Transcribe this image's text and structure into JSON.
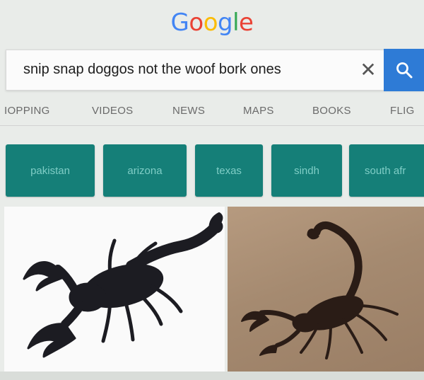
{
  "logo": {
    "letters": [
      {
        "ch": "G",
        "color": "#4285f4"
      },
      {
        "ch": "o",
        "color": "#ea4335"
      },
      {
        "ch": "o",
        "color": "#fbbc05"
      },
      {
        "ch": "g",
        "color": "#4285f4"
      },
      {
        "ch": "l",
        "color": "#34a853"
      },
      {
        "ch": "e",
        "color": "#ea4335"
      }
    ]
  },
  "search": {
    "query": "snip snap doggos not the woof bork ones",
    "clear_icon": "close-icon",
    "button_icon": "search-icon",
    "button_color": "#2e7bd6"
  },
  "tabs": [
    "IOPPING",
    "VIDEOS",
    "NEWS",
    "MAPS",
    "BOOKS",
    "FLIG"
  ],
  "chips": [
    "pakistan",
    "arizona",
    "texas",
    "sindh",
    "south afr"
  ],
  "colors": {
    "chip_bg": "#157f78",
    "chip_text": "#7fcdc6"
  },
  "images": [
    {
      "subject": "scorpion",
      "background": "white"
    },
    {
      "subject": "scorpion",
      "background": "sand"
    }
  ]
}
